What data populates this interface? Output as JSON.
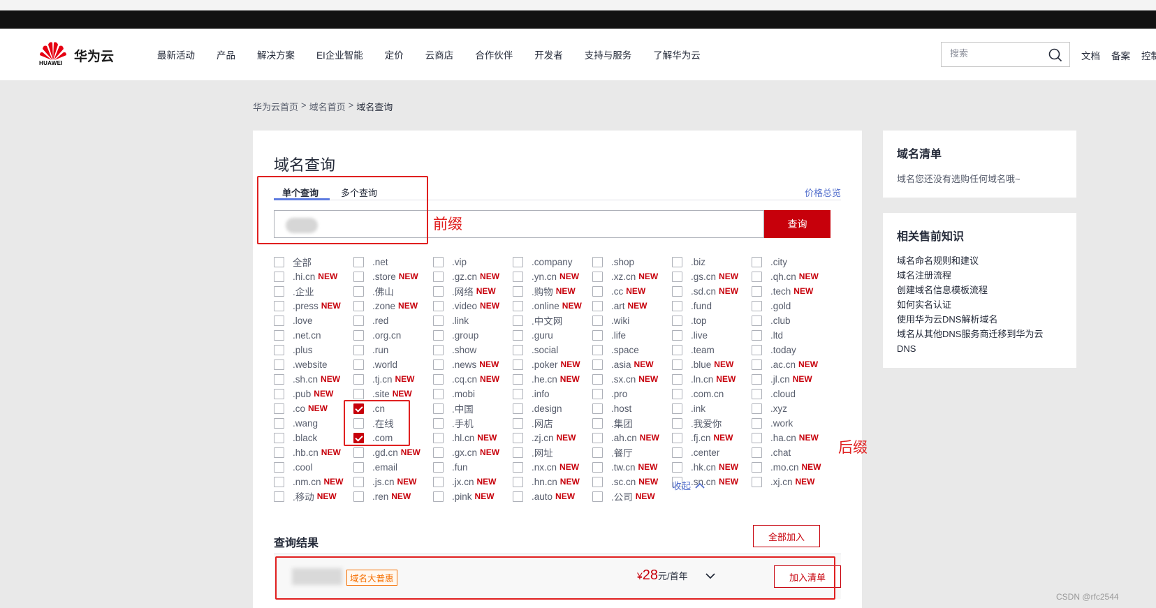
{
  "header": {
    "brand": "华为云",
    "logo_sub": "HUAWEI",
    "nav": [
      "最新活动",
      "产品",
      "解决方案",
      "EI企业智能",
      "定价",
      "云商店",
      "合作伙伴",
      "开发者",
      "支持与服务",
      "了解华为云"
    ],
    "search_placeholder": "搜索",
    "links": [
      "文档",
      "备案",
      "控制台"
    ]
  },
  "breadcrumb": {
    "items": [
      "华为云首页",
      ">",
      "域名首页",
      ">",
      "域名查询"
    ]
  },
  "main": {
    "title": "域名查询",
    "tabs": [
      "单个查询",
      "多个查询"
    ],
    "price_link": "价格总览",
    "query_value": "",
    "query_button": "查询",
    "collapse_label": "收起",
    "results_title": "查询结果",
    "add_all_button": "全部加入",
    "result": {
      "promo_tag": "域名大普惠",
      "currency": "¥",
      "amount": "28",
      "unit": "元/首年",
      "add_button": "加入清单"
    }
  },
  "suffix_new_label": "NEW",
  "suffix_grid": [
    [
      {
        "l": "全部"
      },
      {
        "l": ".hi.cn",
        "n": 1
      },
      {
        "l": ".企业"
      },
      {
        "l": ".press",
        "n": 1
      },
      {
        "l": ".love"
      },
      {
        "l": ".net.cn"
      },
      {
        "l": ".plus"
      },
      {
        "l": ".website"
      },
      {
        "l": ".sh.cn",
        "n": 1
      },
      {
        "l": ".pub",
        "n": 1
      },
      {
        "l": ".co",
        "n": 1
      },
      {
        "l": ".wang"
      },
      {
        "l": ".black"
      },
      {
        "l": ".hb.cn",
        "n": 1
      },
      {
        "l": ".cool"
      },
      {
        "l": ".nm.cn",
        "n": 1
      },
      {
        "l": ".移动",
        "n": 1
      }
    ],
    [
      {
        "l": ".net"
      },
      {
        "l": ".store",
        "n": 1
      },
      {
        "l": ".佛山"
      },
      {
        "l": ".zone",
        "n": 1
      },
      {
        "l": ".red"
      },
      {
        "l": ".org.cn"
      },
      {
        "l": ".run"
      },
      {
        "l": ".world"
      },
      {
        "l": ".tj.cn",
        "n": 1
      },
      {
        "l": ".site",
        "n": 1
      },
      {
        "l": ".cn",
        "c": 1
      },
      {
        "l": ".在线"
      },
      {
        "l": ".com",
        "c": 1
      },
      {
        "l": ".gd.cn",
        "n": 1
      },
      {
        "l": ".email"
      },
      {
        "l": ".js.cn",
        "n": 1
      },
      {
        "l": ".ren",
        "n": 1
      }
    ],
    [
      {
        "l": ".vip"
      },
      {
        "l": ".gz.cn",
        "n": 1
      },
      {
        "l": ".网络",
        "n": 1
      },
      {
        "l": ".video",
        "n": 1
      },
      {
        "l": ".link"
      },
      {
        "l": ".group"
      },
      {
        "l": ".show"
      },
      {
        "l": ".news",
        "n": 1
      },
      {
        "l": ".cq.cn",
        "n": 1
      },
      {
        "l": ".mobi"
      },
      {
        "l": ".中国"
      },
      {
        "l": ".手机"
      },
      {
        "l": ".hl.cn",
        "n": 1
      },
      {
        "l": ".gx.cn",
        "n": 1
      },
      {
        "l": ".fun"
      },
      {
        "l": ".jx.cn",
        "n": 1
      },
      {
        "l": ".pink",
        "n": 1
      }
    ],
    [
      {
        "l": ".company"
      },
      {
        "l": ".yn.cn",
        "n": 1
      },
      {
        "l": ".购物",
        "n": 1
      },
      {
        "l": ".online",
        "n": 1
      },
      {
        "l": ".中文网"
      },
      {
        "l": ".guru"
      },
      {
        "l": ".social"
      },
      {
        "l": ".poker",
        "n": 1
      },
      {
        "l": ".he.cn",
        "n": 1
      },
      {
        "l": ".info"
      },
      {
        "l": ".design"
      },
      {
        "l": ".网店"
      },
      {
        "l": ".zj.cn",
        "n": 1
      },
      {
        "l": ".网址"
      },
      {
        "l": ".nx.cn",
        "n": 1
      },
      {
        "l": ".hn.cn",
        "n": 1
      },
      {
        "l": ".auto",
        "n": 1
      }
    ],
    [
      {
        "l": ".shop"
      },
      {
        "l": ".xz.cn",
        "n": 1
      },
      {
        "l": ".cc",
        "n": 1
      },
      {
        "l": ".art",
        "n": 1
      },
      {
        "l": ".wiki"
      },
      {
        "l": ".life"
      },
      {
        "l": ".space"
      },
      {
        "l": ".asia",
        "n": 1
      },
      {
        "l": ".sx.cn",
        "n": 1
      },
      {
        "l": ".pro"
      },
      {
        "l": ".host"
      },
      {
        "l": ".集团"
      },
      {
        "l": ".ah.cn",
        "n": 1
      },
      {
        "l": ".餐厅"
      },
      {
        "l": ".tw.cn",
        "n": 1
      },
      {
        "l": ".sc.cn",
        "n": 1
      },
      {
        "l": ".公司",
        "n": 1
      }
    ],
    [
      {
        "l": ".biz"
      },
      {
        "l": ".gs.cn",
        "n": 1
      },
      {
        "l": ".sd.cn",
        "n": 1
      },
      {
        "l": ".fund"
      },
      {
        "l": ".top"
      },
      {
        "l": ".live"
      },
      {
        "l": ".team"
      },
      {
        "l": ".blue",
        "n": 1
      },
      {
        "l": ".ln.cn",
        "n": 1
      },
      {
        "l": ".com.cn"
      },
      {
        "l": ".ink"
      },
      {
        "l": ".我爱你"
      },
      {
        "l": ".fj.cn",
        "n": 1
      },
      {
        "l": ".center"
      },
      {
        "l": ".hk.cn",
        "n": 1
      },
      {
        "l": ".sn.cn",
        "n": 1
      }
    ],
    [
      {
        "l": ".city"
      },
      {
        "l": ".qh.cn",
        "n": 1
      },
      {
        "l": ".tech",
        "n": 1
      },
      {
        "l": ".gold"
      },
      {
        "l": ".club"
      },
      {
        "l": ".ltd"
      },
      {
        "l": ".today"
      },
      {
        "l": ".ac.cn",
        "n": 1
      },
      {
        "l": ".jl.cn",
        "n": 1
      },
      {
        "l": ".cloud"
      },
      {
        "l": ".xyz"
      },
      {
        "l": ".work"
      },
      {
        "l": ".ha.cn",
        "n": 1
      },
      {
        "l": ".chat"
      },
      {
        "l": ".mo.cn",
        "n": 1
      },
      {
        "l": ".xj.cn",
        "n": 1
      }
    ]
  ],
  "sidebar": {
    "cart": {
      "title": "域名清单",
      "empty_text": "域名您还没有选购任何域名哦~"
    },
    "knowledge": {
      "title": "相关售前知识",
      "items": [
        "域名命名规则和建议",
        "域名注册流程",
        "创建域名信息模板流程",
        "如何实名认证",
        "使用华为云DNS解析域名",
        "域名从其他DNS服务商迁移到华为云",
        "DNS"
      ]
    }
  },
  "annotations": {
    "prefix_label": "前缀",
    "suffix_label": "后缀"
  },
  "watermark": "CSDN @rfc2544",
  "colors": {
    "brand_red": "#c7000b",
    "link_blue": "#526ecc",
    "annotation_red": "#e02020"
  }
}
